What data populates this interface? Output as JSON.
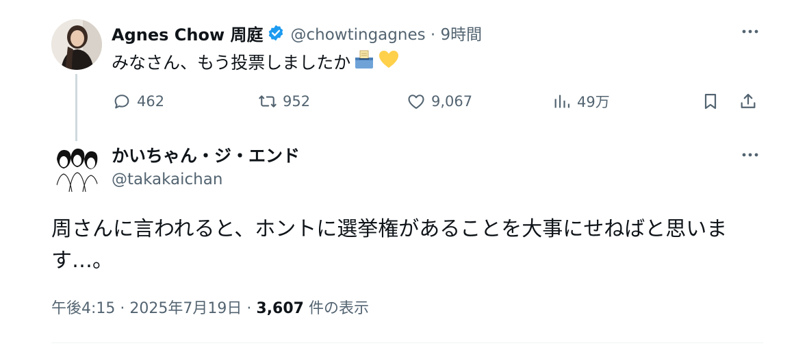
{
  "parent": {
    "display_name": "Agnes Chow 周庭",
    "handle": "@chowtingagnes",
    "separator": "·",
    "time": "9時間",
    "text": "みなさん、もう投票しましたか",
    "emojis": [
      "ballot-box-icon",
      "yellow-heart-icon"
    ],
    "stats": {
      "replies": "462",
      "reposts": "952",
      "likes": "9,067",
      "views": "49万"
    }
  },
  "reply": {
    "display_name": "かいちゃん・ジ・エンド",
    "handle": "@takakaichan",
    "text": "周さんに言われると、ホントに選挙権があることを大事にせねばと思います…。",
    "time": "午後4:15",
    "date": "2025年7月19日",
    "sep": "·",
    "view_count": "3,607",
    "view_suffix": "件の表示"
  },
  "colors": {
    "text_primary": "#0f1419",
    "text_secondary": "#536471",
    "verified": "#1d9bf0",
    "heart": "#ffd04a",
    "thread_line": "#cfd9de"
  }
}
